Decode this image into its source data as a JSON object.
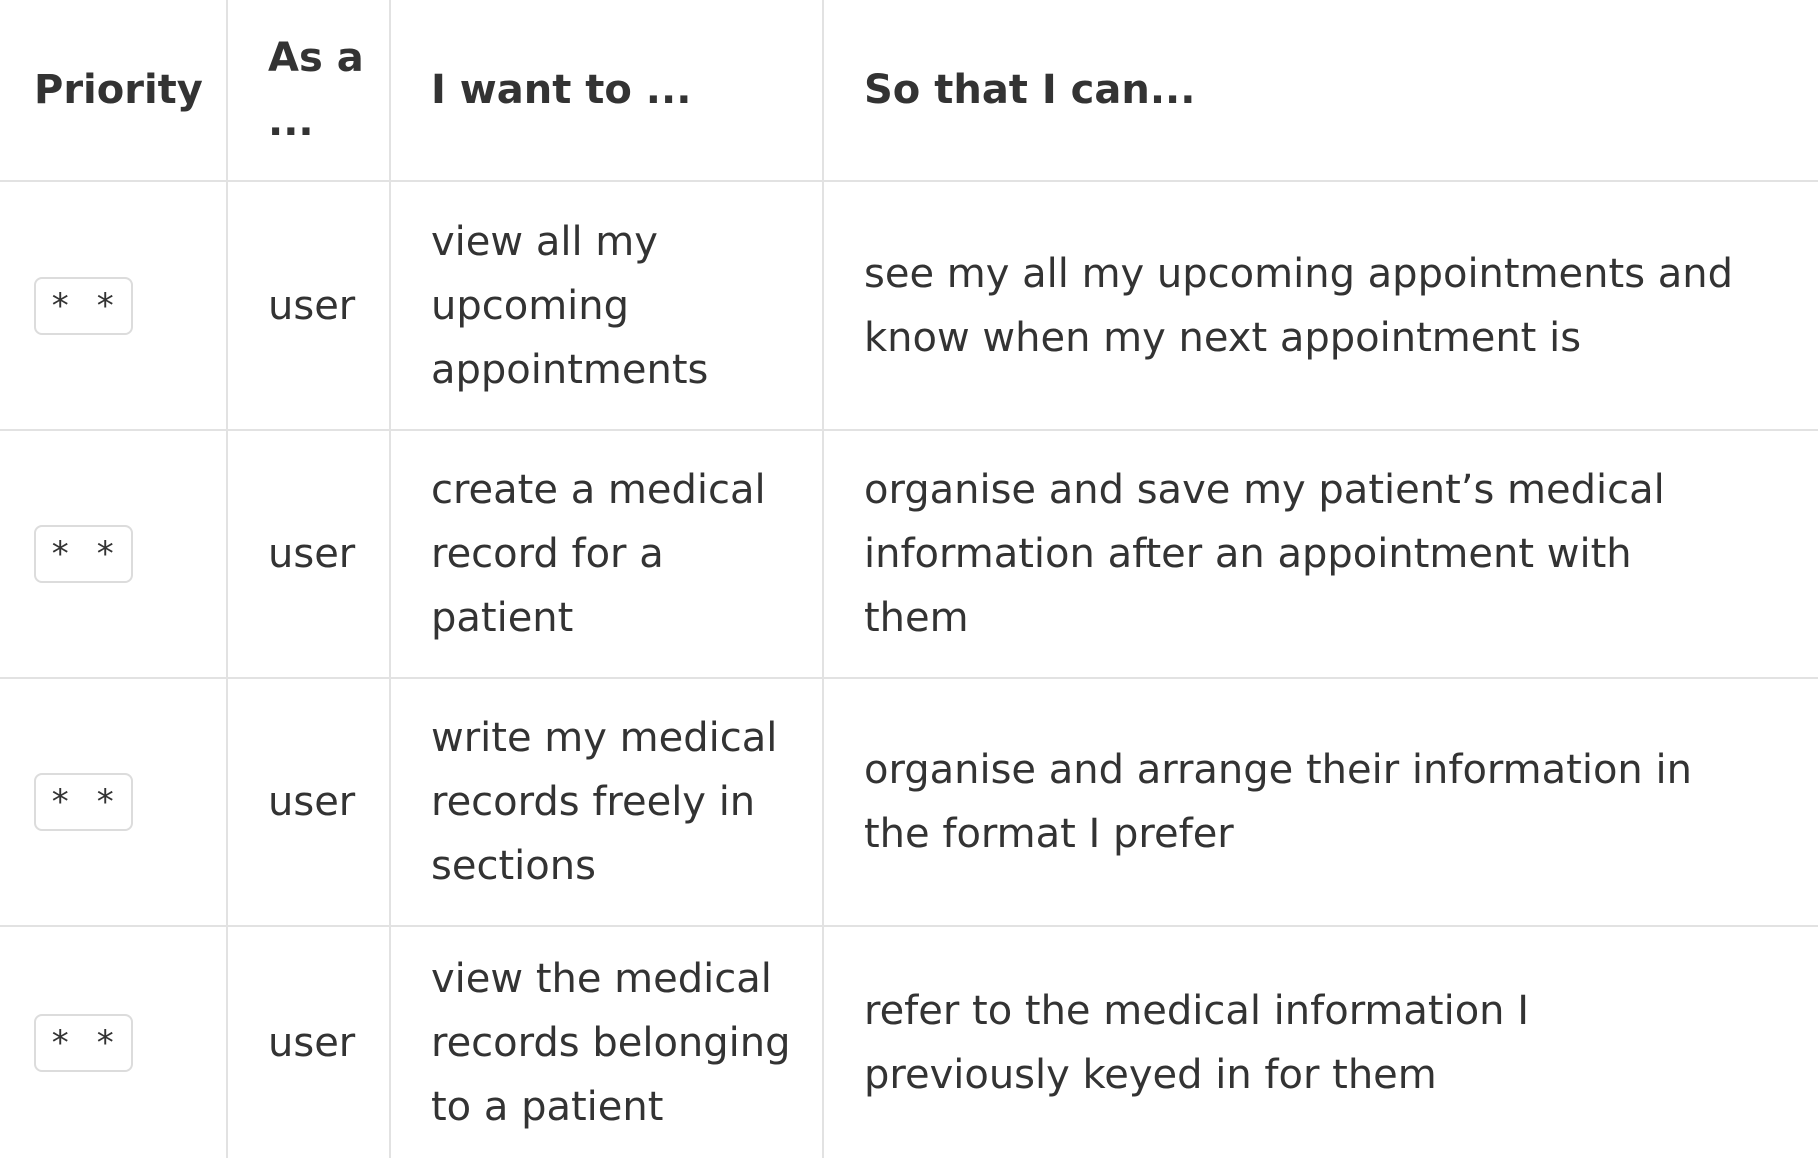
{
  "headers": {
    "priority": "Priority",
    "as_a": "As a ...",
    "i_want_to": "I want to ...",
    "so_that": "So that I can..."
  },
  "rows": [
    {
      "priority": "* *",
      "role": "user",
      "want": "view all my upcoming appointments",
      "so_that": "see my all my upcoming appointments and know when my next appointment is"
    },
    {
      "priority": "* *",
      "role": "user",
      "want": "create a medical record for a patient",
      "so_that": "organise and save my patient’s medical information after an appointment with them"
    },
    {
      "priority": "* *",
      "role": "user",
      "want": "write my medical records freely in sections",
      "so_that": "organise and arrange their information in the format I prefer"
    },
    {
      "priority": "* *",
      "role": "user",
      "want": "view the medical records belonging to a patient",
      "so_that": "refer to the medical information I previously keyed in for them"
    }
  ]
}
